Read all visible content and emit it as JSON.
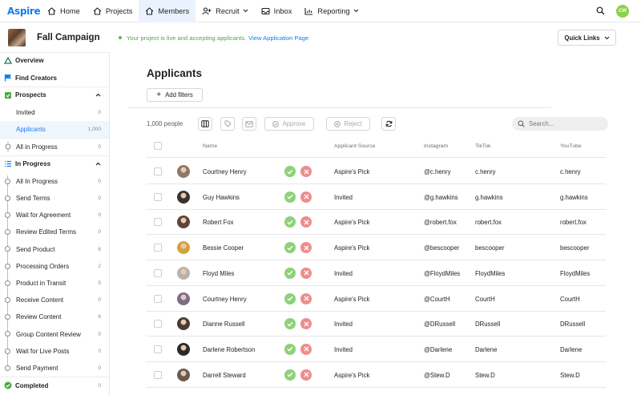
{
  "app": {
    "logo": "Aspire",
    "user_initials": "CW"
  },
  "nav": {
    "items": [
      {
        "label": "Home",
        "icon": "home-icon"
      },
      {
        "label": "Projects",
        "icon": "projects-icon"
      },
      {
        "label": "Members",
        "icon": "members-icon",
        "active": true
      },
      {
        "label": "Recruit",
        "icon": "recruit-icon",
        "dropdown": true
      },
      {
        "label": "Inbox",
        "icon": "inbox-icon"
      },
      {
        "label": "Reporting",
        "icon": "reporting-icon",
        "dropdown": true
      }
    ]
  },
  "campaign": {
    "title": "Fall Campaign",
    "status_text": "Your project is live and accepting applicants.",
    "status_link": "View Application Page",
    "quick_links": "Quick Links"
  },
  "sidebar": {
    "overview": "Overview",
    "find_creators": "Find Creators",
    "prospects": {
      "label": "Prospects",
      "items": [
        {
          "label": "Invited",
          "count": "0"
        },
        {
          "label": "Applicants",
          "count": "1,000",
          "selected": true
        }
      ]
    },
    "all_in_progress": {
      "label": "All in Progress",
      "count": "0"
    },
    "in_progress": {
      "label": "In Progress",
      "items": [
        {
          "label": "All In Progress",
          "count": "0"
        },
        {
          "label": "Send Terms",
          "count": "0"
        },
        {
          "label": "Wait for Agreement",
          "count": "0"
        },
        {
          "label": "Review Edited Terms",
          "count": "0"
        },
        {
          "label": "Send Product",
          "count": "8"
        },
        {
          "label": "Processing Orders",
          "count": "2"
        },
        {
          "label": "Product in Transit",
          "count": "5"
        },
        {
          "label": "Receive Content",
          "count": "0"
        },
        {
          "label": "Review Content",
          "count": "6"
        },
        {
          "label": "Group Content Review",
          "count": "0"
        },
        {
          "label": "Wait for Live Posts",
          "count": "0"
        },
        {
          "label": "Send Payment",
          "count": "0"
        }
      ]
    },
    "completed": {
      "label": "Completed",
      "count": "0"
    }
  },
  "main": {
    "title": "Applicants",
    "add_filters": "Add filters",
    "count_label": "1,000 people",
    "approve": "Approve",
    "reject": "Reject",
    "search_placeholder": "Search..."
  },
  "table": {
    "columns": [
      "Name",
      "Applicant Source",
      "Instagram",
      "TikTok",
      "YouTube"
    ],
    "rows": [
      {
        "name": "Courtney Henry",
        "source": "Aspire's Pick",
        "instagram": "@c.henry",
        "tiktok": "c.henry",
        "youtube": "c.henry",
        "avatar_color": "#8e7868"
      },
      {
        "name": "Guy Hawkins",
        "source": "Invited",
        "instagram": "@g.hawkins",
        "tiktok": "g.hawkins",
        "youtube": "g.hawkins",
        "avatar_color": "#3b3230"
      },
      {
        "name": "Robert Fox",
        "source": "Aspire's Pick",
        "instagram": "@robert.fox",
        "tiktok": "robert.fox",
        "youtube": "robert.fox",
        "avatar_color": "#5c4538"
      },
      {
        "name": "Bessie Cooper",
        "source": "Aspire's Pick",
        "instagram": "@bescooper",
        "tiktok": "bescooper",
        "youtube": "bescooper",
        "avatar_color": "#d4a23c"
      },
      {
        "name": "Floyd Miles",
        "source": "Invited",
        "instagram": "@FloydMiles",
        "tiktok": "FloydMiles",
        "youtube": "FloydMiles",
        "avatar_color": "#b9b2aa"
      },
      {
        "name": "Courtney Henry",
        "source": "Aspire's Pick",
        "instagram": "@CourtH",
        "tiktok": "CourtH",
        "youtube": "CourtH",
        "avatar_color": "#7a6f8a"
      },
      {
        "name": "Dianne Russell",
        "source": "Invited",
        "instagram": "@DRussell",
        "tiktok": "DRussell",
        "youtube": "DRussell",
        "avatar_color": "#4a3a34"
      },
      {
        "name": "Darlene Robertson",
        "source": "Invited",
        "instagram": "@Darlene",
        "tiktok": "Darlene",
        "youtube": "Darlene",
        "avatar_color": "#2f2a2a"
      },
      {
        "name": "Darrell Steward",
        "source": "Aspire's Pick",
        "instagram": "@Stew.D",
        "tiktok": "Stew.D",
        "youtube": "Stew.D",
        "avatar_color": "#6a5a4e"
      }
    ]
  },
  "colors": {
    "brand": "#167cf4",
    "approve": "#8fd17a",
    "reject": "#ee8d8d",
    "live": "#4ea844"
  }
}
